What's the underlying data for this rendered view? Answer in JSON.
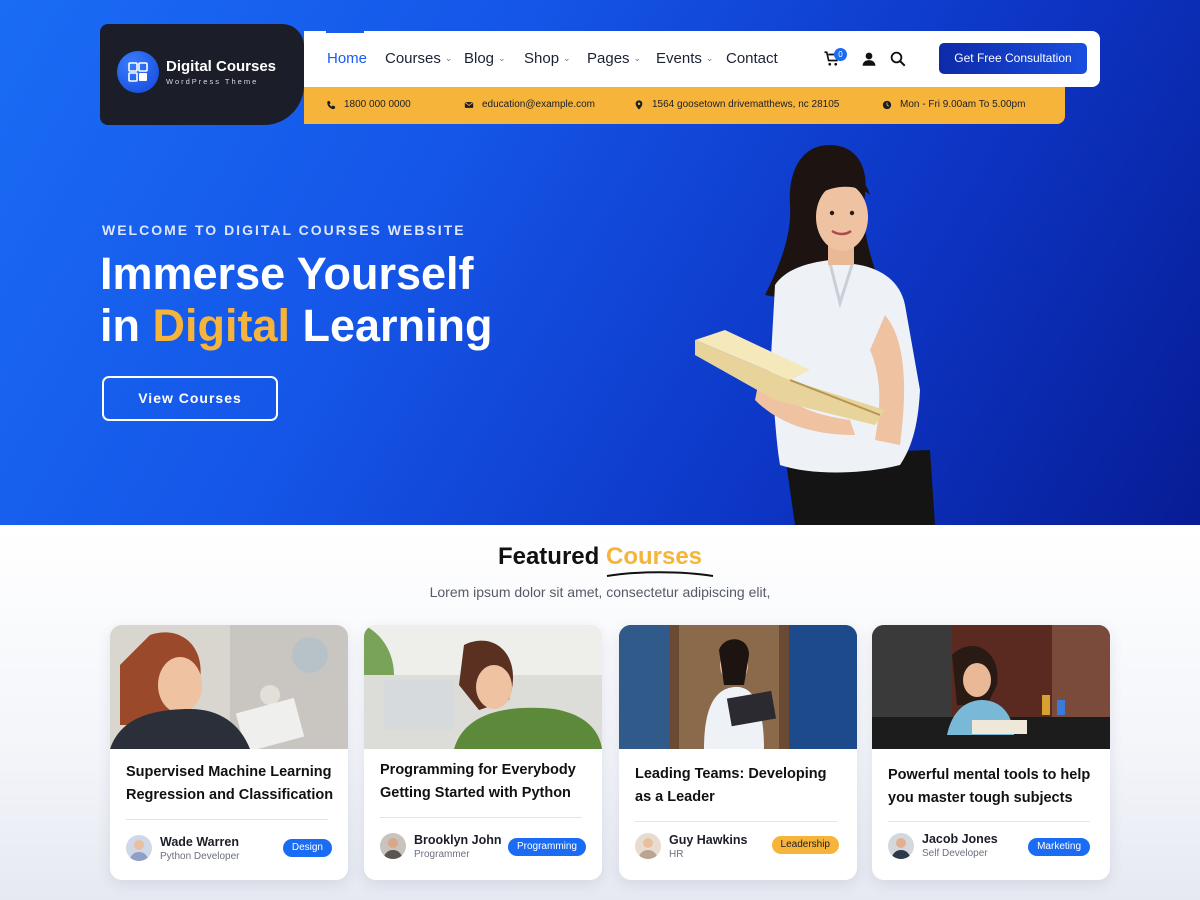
{
  "brand": {
    "name": "Digital Courses",
    "tagline": "WordPress Theme"
  },
  "nav": {
    "items": [
      {
        "label": "Home",
        "dropdown": false,
        "active": true
      },
      {
        "label": "Courses",
        "dropdown": true
      },
      {
        "label": "Blog",
        "dropdown": true
      },
      {
        "label": "Shop",
        "dropdown": true
      },
      {
        "label": "Pages",
        "dropdown": true
      },
      {
        "label": "Events",
        "dropdown": true
      },
      {
        "label": "Contact",
        "dropdown": false
      }
    ],
    "cart_count": "0",
    "cta_label": "Get Free Consultation",
    "icons": [
      "cart-icon",
      "user-icon",
      "search-icon"
    ]
  },
  "info": {
    "phone": "1800 000 0000",
    "email": "education@example.com",
    "address": "1564 goosetown drivematthews, nc 28105",
    "hours": "Mon - Fri  9.00am To 5.00pm"
  },
  "hero": {
    "kicker": "WELCOME TO DIGITAL COURSES WEBSITE",
    "headline_line1": "Immerse Yourself",
    "headline_in": "in ",
    "headline_highlight": "Digital",
    "headline_end": " Learning",
    "button_label": "View Courses"
  },
  "featured": {
    "title_main": "Featured ",
    "title_highlight": "Courses",
    "subtitle": "Lorem ipsum dolor sit amet, consectetur adipiscing elit,",
    "courses": [
      {
        "title": "Supervised Machine Learning Regression and Classification",
        "author": "Wade Warren",
        "role": "Python Developer",
        "tag": "Design",
        "tag_color": "#1a6cf5"
      },
      {
        "title": "Programming for Everybody Getting Started with Python",
        "author": "Brooklyn John",
        "role": "Programmer",
        "tag": "Programming",
        "tag_color": "#1a6cf5"
      },
      {
        "title": "Leading Teams: Developing as a Leader",
        "author": "Guy Hawkins",
        "role": "HR",
        "tag": "Leadership",
        "tag_color": "#f7b43a"
      },
      {
        "title": "Powerful mental tools to help you master tough subjects",
        "author": "Jacob Jones",
        "role": "Self Developer",
        "tag": "Marketing",
        "tag_color": "#1a6cf5"
      }
    ]
  },
  "colors": {
    "primary": "#1a6cf5",
    "accent": "#f7b43a",
    "dark": "#1b1e28"
  }
}
